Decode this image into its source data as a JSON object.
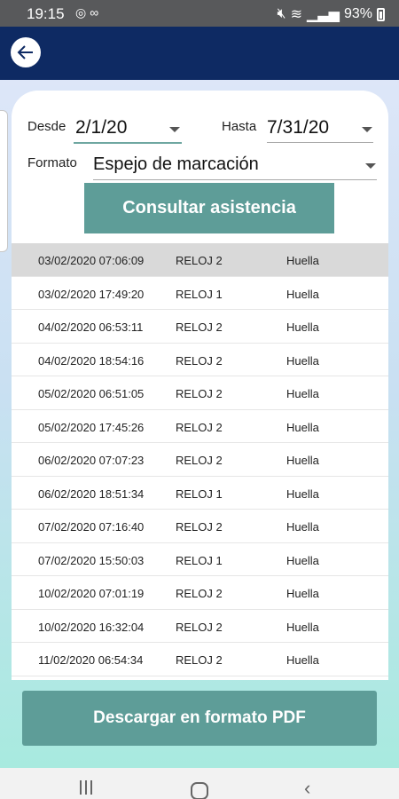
{
  "status_bar": {
    "time": "19:15",
    "app_icons": [
      "whatsapp-icon",
      "voicemail-icon"
    ],
    "battery": "93%",
    "system_icons": [
      "mute-icon",
      "wifi-icon",
      "signal-icon",
      "battery-icon"
    ]
  },
  "app_bar": {
    "back_icon": "arrow-left-icon",
    "background_color": "#0e2a63"
  },
  "filters": {
    "from_label": "Desde",
    "from_value": "2/1/20",
    "to_label": "Hasta",
    "to_value": "7/31/20",
    "format_label": "Formato",
    "format_value": "Espejo de marcación"
  },
  "consult_button": {
    "label": "Consultar asistencia",
    "color": "#5e9d98"
  },
  "records": [
    {
      "datetime": "03/02/2020 07:06:09",
      "device": "RELOJ 2",
      "method": "Huella",
      "selected": true
    },
    {
      "datetime": "03/02/2020 17:49:20",
      "device": "RELOJ 1",
      "method": "Huella"
    },
    {
      "datetime": "04/02/2020 06:53:11",
      "device": "RELOJ 2",
      "method": "Huella"
    },
    {
      "datetime": "04/02/2020 18:54:16",
      "device": "RELOJ 2",
      "method": "Huella"
    },
    {
      "datetime": "05/02/2020 06:51:05",
      "device": "RELOJ 2",
      "method": "Huella"
    },
    {
      "datetime": "05/02/2020 17:45:26",
      "device": "RELOJ 2",
      "method": "Huella"
    },
    {
      "datetime": "06/02/2020 07:07:23",
      "device": "RELOJ 2",
      "method": "Huella"
    },
    {
      "datetime": "06/02/2020 18:51:34",
      "device": "RELOJ 1",
      "method": "Huella"
    },
    {
      "datetime": "07/02/2020 07:16:40",
      "device": "RELOJ 2",
      "method": "Huella"
    },
    {
      "datetime": "07/02/2020 15:50:03",
      "device": "RELOJ 1",
      "method": "Huella"
    },
    {
      "datetime": "10/02/2020 07:01:19",
      "device": "RELOJ 2",
      "method": "Huella"
    },
    {
      "datetime": "10/02/2020 16:32:04",
      "device": "RELOJ 2",
      "method": "Huella"
    },
    {
      "datetime": "11/02/2020 06:54:34",
      "device": "RELOJ 2",
      "method": "Huella"
    }
  ],
  "pdf_button": {
    "label": "Descargar en formato PDF"
  },
  "nav_bar": {
    "icons": [
      "recents-icon",
      "home-icon",
      "back-icon"
    ]
  }
}
